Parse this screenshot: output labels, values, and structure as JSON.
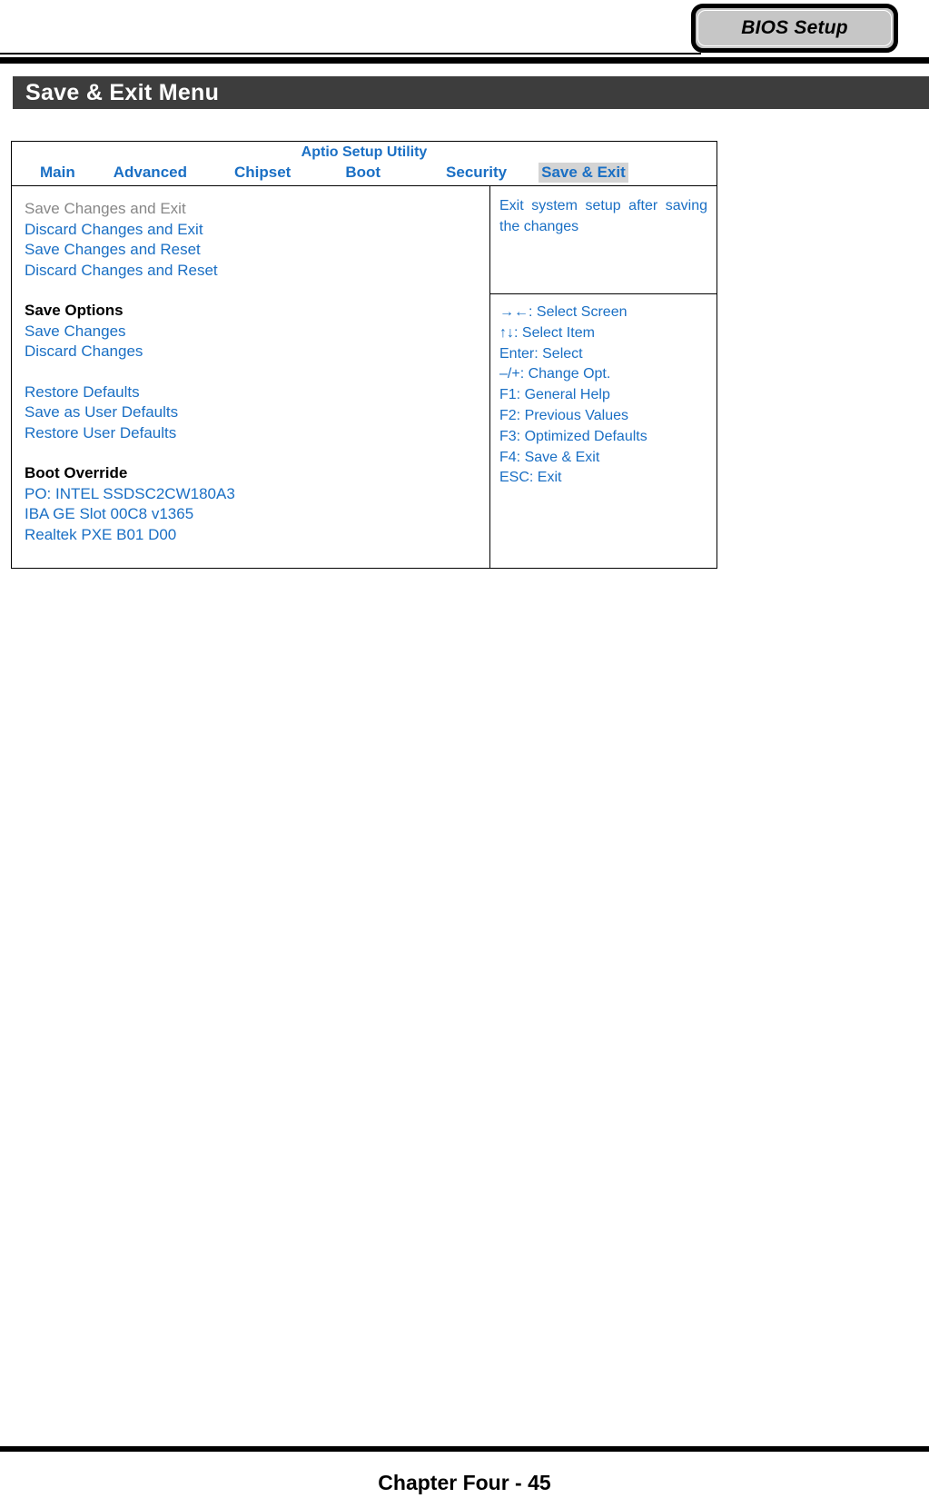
{
  "page_header": {
    "tab_badge_label": "BIOS Setup"
  },
  "section": {
    "title": "Save & Exit Menu"
  },
  "bios": {
    "utility_title": "Aptio Setup Utility",
    "tabs": [
      {
        "label": "Main",
        "active": false
      },
      {
        "label": "Advanced",
        "active": false
      },
      {
        "label": "Chipset",
        "active": false
      },
      {
        "label": "Boot",
        "active": false
      },
      {
        "label": "Security",
        "active": false
      },
      {
        "label": "Save & Exit",
        "active": true
      }
    ],
    "menu": [
      {
        "label": "Save Changes and Exit",
        "style": "selected"
      },
      {
        "label": "Discard Changes and Exit",
        "style": "item"
      },
      {
        "label": "Save Changes and Reset",
        "style": "item"
      },
      {
        "label": "Discard Changes and Reset",
        "style": "item"
      },
      {
        "label": "",
        "style": "gap"
      },
      {
        "label": "Save Options",
        "style": "heading"
      },
      {
        "label": "Save Changes",
        "style": "item"
      },
      {
        "label": "Discard Changes",
        "style": "item"
      },
      {
        "label": "",
        "style": "gap"
      },
      {
        "label": "Restore Defaults",
        "style": "item"
      },
      {
        "label": "Save as User Defaults",
        "style": "item"
      },
      {
        "label": "Restore User Defaults",
        "style": "item"
      },
      {
        "label": "",
        "style": "gap"
      },
      {
        "label": "Boot Override",
        "style": "heading"
      },
      {
        "label": "PO: INTEL SSDSC2CW180A3",
        "style": "item"
      },
      {
        "label": "IBA GE Slot 00C8 v1365",
        "style": "item"
      },
      {
        "label": "Realtek PXE B01 D00",
        "style": "item"
      }
    ],
    "help_text": "Exit system setup after saving the changes",
    "key_legend": [
      "→←: Select Screen",
      "↑↓: Select Item",
      "Enter: Select",
      "–/+: Change Opt.",
      "F1: General Help",
      "F2: Previous Values",
      "F3: Optimized Defaults",
      "F4: Save & Exit",
      "ESC: Exit"
    ]
  },
  "footer": {
    "text": "Chapter Four - 45"
  },
  "colors": {
    "bios_blue": "#1a6fc4",
    "selected_gray": "#878787",
    "tab_highlight": "#d4d4d4",
    "banner_bg": "#3d3d3d",
    "badge_bg": "#c6c6c6"
  }
}
